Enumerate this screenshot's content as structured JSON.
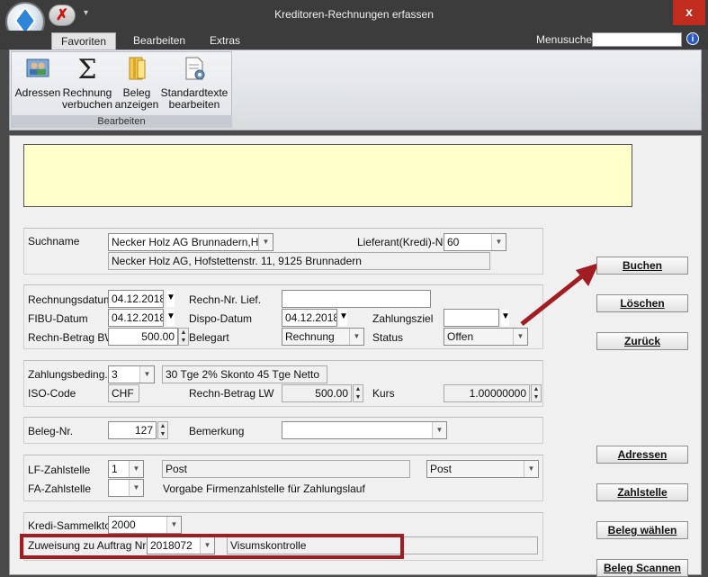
{
  "window": {
    "title": "Kreditoren-Rechnungen erfassen",
    "close_glyph": "x"
  },
  "qat": {
    "close_glyph": "✗",
    "dropdown_glyph": "▾"
  },
  "ribbon": {
    "tabs": [
      "Favoriten",
      "Bearbeiten",
      "Extras"
    ],
    "menusuche_label": "Menusuche",
    "menusuche_value": "",
    "help_glyph": "i",
    "group_label": "Bearbeiten",
    "buttons": [
      {
        "line1": "Adressen",
        "line2": "",
        "icon": "address-book-icon"
      },
      {
        "line1": "Rechnung",
        "line2": "verbuchen",
        "icon": "sigma-icon"
      },
      {
        "line1": "Beleg",
        "line2": "anzeigen",
        "icon": "binder-icon"
      },
      {
        "line1": "Standardtexte",
        "line2": "bearbeiten",
        "icon": "document-gear-icon"
      }
    ]
  },
  "lieferant": {
    "suchname_label": "Suchname",
    "suchname_value": "Necker Holz AG Brunnadern,Hofs",
    "address": "Necker Holz AG, Hofstettenstr. 11, 9125 Brunnadern",
    "nr_label": "Lieferant(Kredi)-Nr",
    "nr_value": "60"
  },
  "rechnung": {
    "rechnungsdatum_label": "Rechnungsdatum",
    "rechnungsdatum_value": "04.12.2018",
    "rechn_nr_lief_label": "Rechn-Nr. Lief.",
    "rechn_nr_lief_value": "",
    "fibu_label": "FIBU-Datum",
    "fibu_value": "04.12.2018",
    "dispo_label": "Dispo-Datum",
    "dispo_value": "04.12.2018",
    "zahlungsziel_label": "Zahlungsziel",
    "zahlungsziel_value": "",
    "betrag_bw_label": "Rechn-Betrag BW",
    "betrag_bw_value": "500.00",
    "belegart_label": "Belegart",
    "belegart_value": "Rechnung",
    "status_label": "Status",
    "status_value": "Offen"
  },
  "zahlung": {
    "bedingung_label": "Zahlungsbeding.",
    "bedingung_value": "3",
    "bedingung_text": "30 Tge 2% Skonto 45 Tge Netto",
    "iso_label": "ISO-Code",
    "iso_value": "CHF",
    "betrag_lw_label": "Rechn-Betrag LW",
    "betrag_lw_value": "500.00",
    "kurs_label": "Kurs",
    "kurs_value": "1.00000000"
  },
  "beleg": {
    "nr_label": "Beleg-Nr.",
    "nr_value": "127",
    "bemerkung_label": "Bemerkung",
    "bemerkung_value": ""
  },
  "zahlstelle": {
    "lf_label": "LF-Zahlstelle",
    "lf_value": "1",
    "lf_text": "Post",
    "lf_select": "Post",
    "fa_label": "FA-Zahlstelle",
    "fa_value": "",
    "fa_text": "Vorgabe Firmenzahlstelle für Zahlungslauf"
  },
  "sammel": {
    "konto_label": "Kredi-Sammelkto",
    "konto_value": "2000",
    "zuweisung_label": "Zuweisung zu Auftrag Nr:",
    "zuweisung_value": "2018072",
    "visum_text": "Visumskontrolle"
  },
  "actions": {
    "buchen": "Buchen",
    "loeschen": "Löschen",
    "zurueck": "Zurück",
    "adressen": "Adressen",
    "zahlstelle": "Zahlstelle",
    "beleg_waehlen": "Beleg wählen",
    "beleg_scannen": "Beleg Scannen"
  },
  "colors": {
    "annotation_red": "#a21d22",
    "info_yellow": "#ffffcc",
    "close_red": "#c12c1f"
  }
}
